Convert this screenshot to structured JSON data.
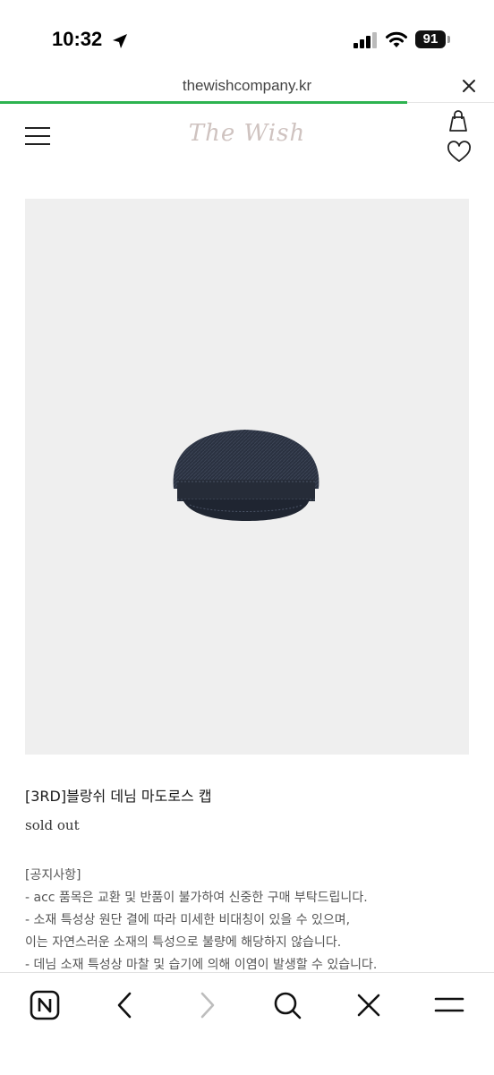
{
  "status_bar": {
    "time": "10:32",
    "battery": "91"
  },
  "url_bar": {
    "url": "thewishcompany.kr"
  },
  "site_header": {
    "logo": "The Wish"
  },
  "product": {
    "title": "[3RD]블랑쉬 데님 마도로스 캡",
    "status": "sold out"
  },
  "notice": {
    "heading": "[공지사항]",
    "lines": [
      "- acc 품목은 교환 및 반품이 불가하여 신중한 구매 부탁드립니다.",
      "- 소재 특성상 원단 결에 따라 미세한 비대칭이 있을 수 있으며,",
      "이는 자연스러운 소재의 특성으로 불량에 해당하지 않습니다.",
      "- 데님 소재 특성상 마찰 및 습기에 의해 이염이 발생할 수 있습니다."
    ]
  },
  "colors": {
    "progress": "#2db350",
    "image_bg": "#efefef",
    "logo": "#cfc3c0"
  },
  "toolbar": {
    "icons": [
      "naver-home-icon",
      "back-icon",
      "forward-icon",
      "search-icon",
      "close-icon",
      "menu-icon"
    ]
  }
}
